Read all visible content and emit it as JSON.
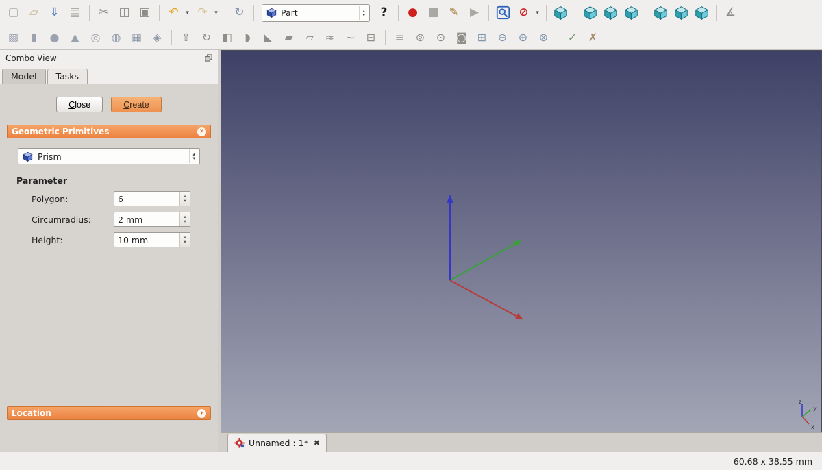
{
  "colors": {
    "accent-orange-1": "#f5a468",
    "accent-orange-2": "#ec8340",
    "viewport-top": "#3e4066",
    "viewport-bottom": "#a3a6b5",
    "axis-x": "#b83a3a",
    "axis-y": "#3aa03a",
    "axis-z": "#3535c8"
  },
  "icons": {
    "dropdown": "▾",
    "spin_up": "▴",
    "spin_down": "▾",
    "close_tab": "✖",
    "section_collapse": "✕",
    "section_expand": "▾"
  },
  "toolbar_row1": [
    {
      "name": "new-document-icon",
      "glyph": "▢",
      "color": "#b5b5b0"
    },
    {
      "name": "open-icon",
      "glyph": "▱",
      "color": "#c4b089"
    },
    {
      "name": "save-icon",
      "glyph": "⇓",
      "color": "#4a78c4"
    },
    {
      "name": "print-icon",
      "glyph": "▤",
      "color": "#a5a5a0"
    },
    {
      "sep": true
    },
    {
      "name": "cut-icon",
      "glyph": "✂",
      "color": "#8c8c88"
    },
    {
      "name": "copy-icon",
      "glyph": "◫",
      "color": "#8c8c88"
    },
    {
      "name": "paste-icon",
      "glyph": "▣",
      "color": "#8c8c88"
    },
    {
      "sep": true
    },
    {
      "name": "undo-icon",
      "glyph": "↶",
      "color": "#e3aa28",
      "dropdown": true
    },
    {
      "name": "redo-icon",
      "glyph": "↷",
      "color": "#d9c49a",
      "dropdown": true
    },
    {
      "sep": true
    },
    {
      "name": "refresh-icon",
      "glyph": "↻",
      "color": "#7d8ea6"
    },
    {
      "sep": true
    },
    {
      "combo": true
    },
    {
      "name": "whatsthis-icon",
      "glyph": "?",
      "color": "#1a1a1a",
      "bold": true
    },
    {
      "sep": true
    },
    {
      "name": "macro-record-icon",
      "glyph": "●",
      "color": "#cf1f1f"
    },
    {
      "name": "macro-stop-icon",
      "glyph": "■",
      "color": "#a9a9a4"
    },
    {
      "name": "macro-edit-icon",
      "glyph": "✎",
      "color": "#a3762e"
    },
    {
      "name": "macro-play-icon",
      "glyph": "▶",
      "color": "#a9a9a4"
    },
    {
      "sep": true
    },
    {
      "svg": "magnifier",
      "name": "fit-all-icon"
    },
    {
      "name": "draw-style-icon",
      "glyph": "⊘",
      "color": "#cf2222",
      "bold": true,
      "dropdown": true
    },
    {
      "sep": true
    },
    {
      "svg": "cube",
      "name": "axonometric-view-icon"
    },
    {
      "gap": true
    },
    {
      "svg": "cube",
      "name": "front-view-icon"
    },
    {
      "svg": "cube",
      "name": "top-view-icon"
    },
    {
      "svg": "cube",
      "name": "right-view-icon"
    },
    {
      "gap": true
    },
    {
      "svg": "cube",
      "name": "rear-view-icon"
    },
    {
      "svg": "cube",
      "name": "bottom-view-icon"
    },
    {
      "svg": "cube",
      "name": "left-view-icon"
    },
    {
      "sep": true
    },
    {
      "name": "measure-icon",
      "glyph": "∡",
      "color": "#8c8c88"
    }
  ],
  "toolbar_row2": [
    {
      "name": "box-icon",
      "glyph": "▧",
      "color": "#8f9aa8"
    },
    {
      "name": "cylinder-icon",
      "glyph": "▮",
      "color": "#9aa3ad"
    },
    {
      "name": "sphere-icon",
      "glyph": "●",
      "color": "#9aa3ad"
    },
    {
      "name": "cone-icon",
      "glyph": "▲",
      "color": "#9aa3ad"
    },
    {
      "name": "torus-icon",
      "glyph": "◎",
      "color": "#9aa3ad"
    },
    {
      "name": "tube-icon",
      "glyph": "◍",
      "color": "#8f9aa8"
    },
    {
      "name": "create-primitives-icon",
      "glyph": "▦",
      "color": "#8f9aa8"
    },
    {
      "name": "shape-builder-icon",
      "glyph": "◈",
      "color": "#8f9aa8"
    },
    {
      "sep": true
    },
    {
      "name": "extrude-icon",
      "glyph": "⇧",
      "color": "#8f8f8a"
    },
    {
      "name": "revolve-icon",
      "glyph": "↻",
      "color": "#8f8f8a"
    },
    {
      "name": "mirror-icon",
      "glyph": "◧",
      "color": "#8f8f8a"
    },
    {
      "name": "fillet-icon",
      "glyph": "◗",
      "color": "#8f8f8a"
    },
    {
      "name": "chamfer-icon",
      "glyph": "◣",
      "color": "#8f8f8a"
    },
    {
      "name": "make-face-icon",
      "glyph": "▰",
      "color": "#8f8f8a"
    },
    {
      "name": "ruled-surface-icon",
      "glyph": "▱",
      "color": "#8f8f8a"
    },
    {
      "name": "loft-icon",
      "glyph": "≈",
      "color": "#8f8f8a"
    },
    {
      "name": "sweep-icon",
      "glyph": "∼",
      "color": "#8f8f8a"
    },
    {
      "name": "section-icon",
      "glyph": "⊟",
      "color": "#8f8f8a"
    },
    {
      "sep": true
    },
    {
      "name": "cross-sections-icon",
      "glyph": "≡",
      "color": "#8f8f8a"
    },
    {
      "name": "offset-3d-icon",
      "glyph": "⊚",
      "color": "#8f8f8a"
    },
    {
      "name": "offset-2d-icon",
      "glyph": "⊙",
      "color": "#8f8f8a"
    },
    {
      "name": "thickness-icon",
      "glyph": "◙",
      "color": "#8f8f8a"
    },
    {
      "name": "boolean-icon",
      "glyph": "⊞",
      "color": "#7d96ae"
    },
    {
      "name": "boolean-cut-icon",
      "glyph": "⊖",
      "color": "#7d96ae"
    },
    {
      "name": "union-icon",
      "glyph": "⊕",
      "color": "#7d96ae"
    },
    {
      "name": "intersection-icon",
      "glyph": "⊗",
      "color": "#7d96ae"
    },
    {
      "sep": true
    },
    {
      "name": "check-geometry-icon",
      "glyph": "✓",
      "color": "#6f9a6f"
    },
    {
      "name": "defeaturing-icon",
      "glyph": "✗",
      "color": "#a08a6a"
    }
  ],
  "workbench_selector": {
    "value": "Part"
  },
  "combo_view": {
    "title": "Combo View",
    "tabs": [
      {
        "label": "Model"
      },
      {
        "label": "Tasks"
      }
    ],
    "buttons": {
      "close": {
        "mnemonic": "C",
        "rest": "lose"
      },
      "create": {
        "mnemonic": "C",
        "rest": "reate"
      }
    },
    "sections": {
      "primitives": {
        "title": "Geometric Primitives"
      },
      "location": {
        "title": "Location"
      }
    },
    "primitive_type": {
      "value": "Prism"
    },
    "parameter_heading": "Parameter",
    "fields": [
      {
        "label": "Polygon:",
        "value": "6"
      },
      {
        "label": "Circumradius:",
        "value": "2 mm"
      },
      {
        "label": "Height:",
        "value": "10 mm"
      }
    ]
  },
  "document_tab": {
    "label": "Unnamed : 1*"
  },
  "status_bar": {
    "dimension_readout": "60.68 x 38.55 mm"
  }
}
